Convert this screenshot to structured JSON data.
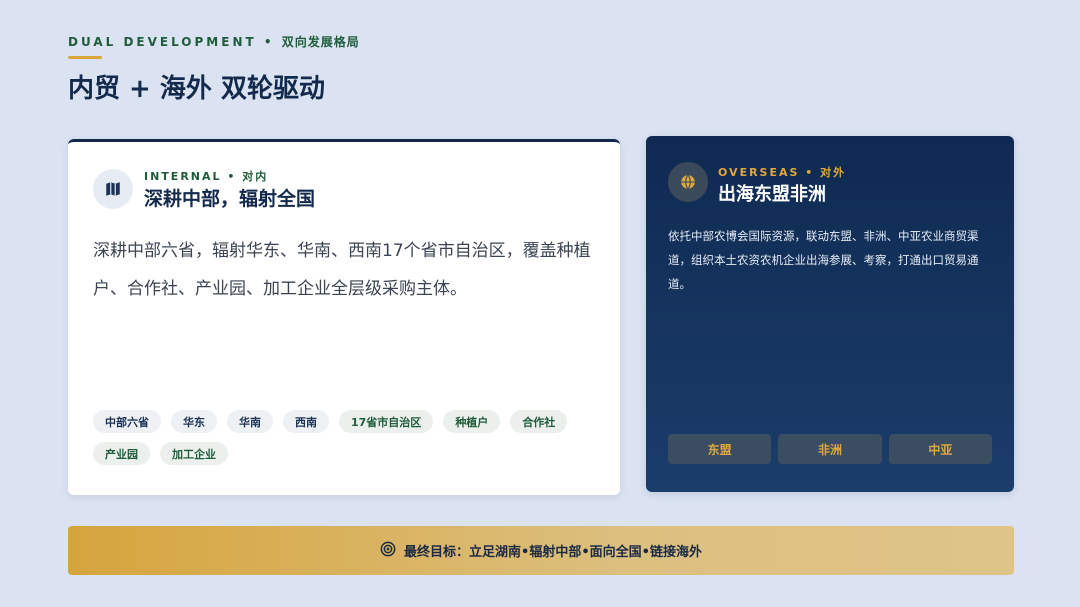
{
  "header": {
    "eyebrow_en": "DUAL DEVELOPMENT",
    "eyebrow_sep": "•",
    "eyebrow_zh": "双向发展格局",
    "title": "内贸 + 海外 双轮驱动"
  },
  "internal": {
    "tag": "INTERNAL • 对内",
    "title": "深耕中部，辐射全国",
    "description": "深耕中部六省，辐射华东、华南、西南17个省市自治区，覆盖种植户、合作社、产业园、加工企业全层级采购主体。",
    "icon": "map-icon",
    "chips": [
      {
        "label": "中部六省",
        "tone": "navy"
      },
      {
        "label": "华东",
        "tone": "navy"
      },
      {
        "label": "华南",
        "tone": "navy"
      },
      {
        "label": "西南",
        "tone": "navy"
      },
      {
        "label": "17省市自治区",
        "tone": "green"
      },
      {
        "label": "种植户",
        "tone": "green"
      },
      {
        "label": "合作社",
        "tone": "green"
      },
      {
        "label": "产业园",
        "tone": "green"
      },
      {
        "label": "加工企业",
        "tone": "green"
      }
    ]
  },
  "overseas": {
    "tag": "OVERSEAS • 对外",
    "title": "出海东盟非洲",
    "description": "依托中部农博会国际资源，联动东盟、非洲、中亚农业商贸渠道，组织本土农资农机企业出海参展、考察，打通出口贸易通道。",
    "icon": "globe-icon",
    "regions": [
      "东盟",
      "非洲",
      "中亚"
    ]
  },
  "goal": {
    "icon": "target-icon",
    "text": "最终目标：立足湖南•辐射中部•面向全国•链接海外"
  },
  "colors": {
    "background": "#dbe3f2",
    "navy": "#132a4d",
    "green": "#1f5c3a",
    "gold": "#d9a63a"
  }
}
